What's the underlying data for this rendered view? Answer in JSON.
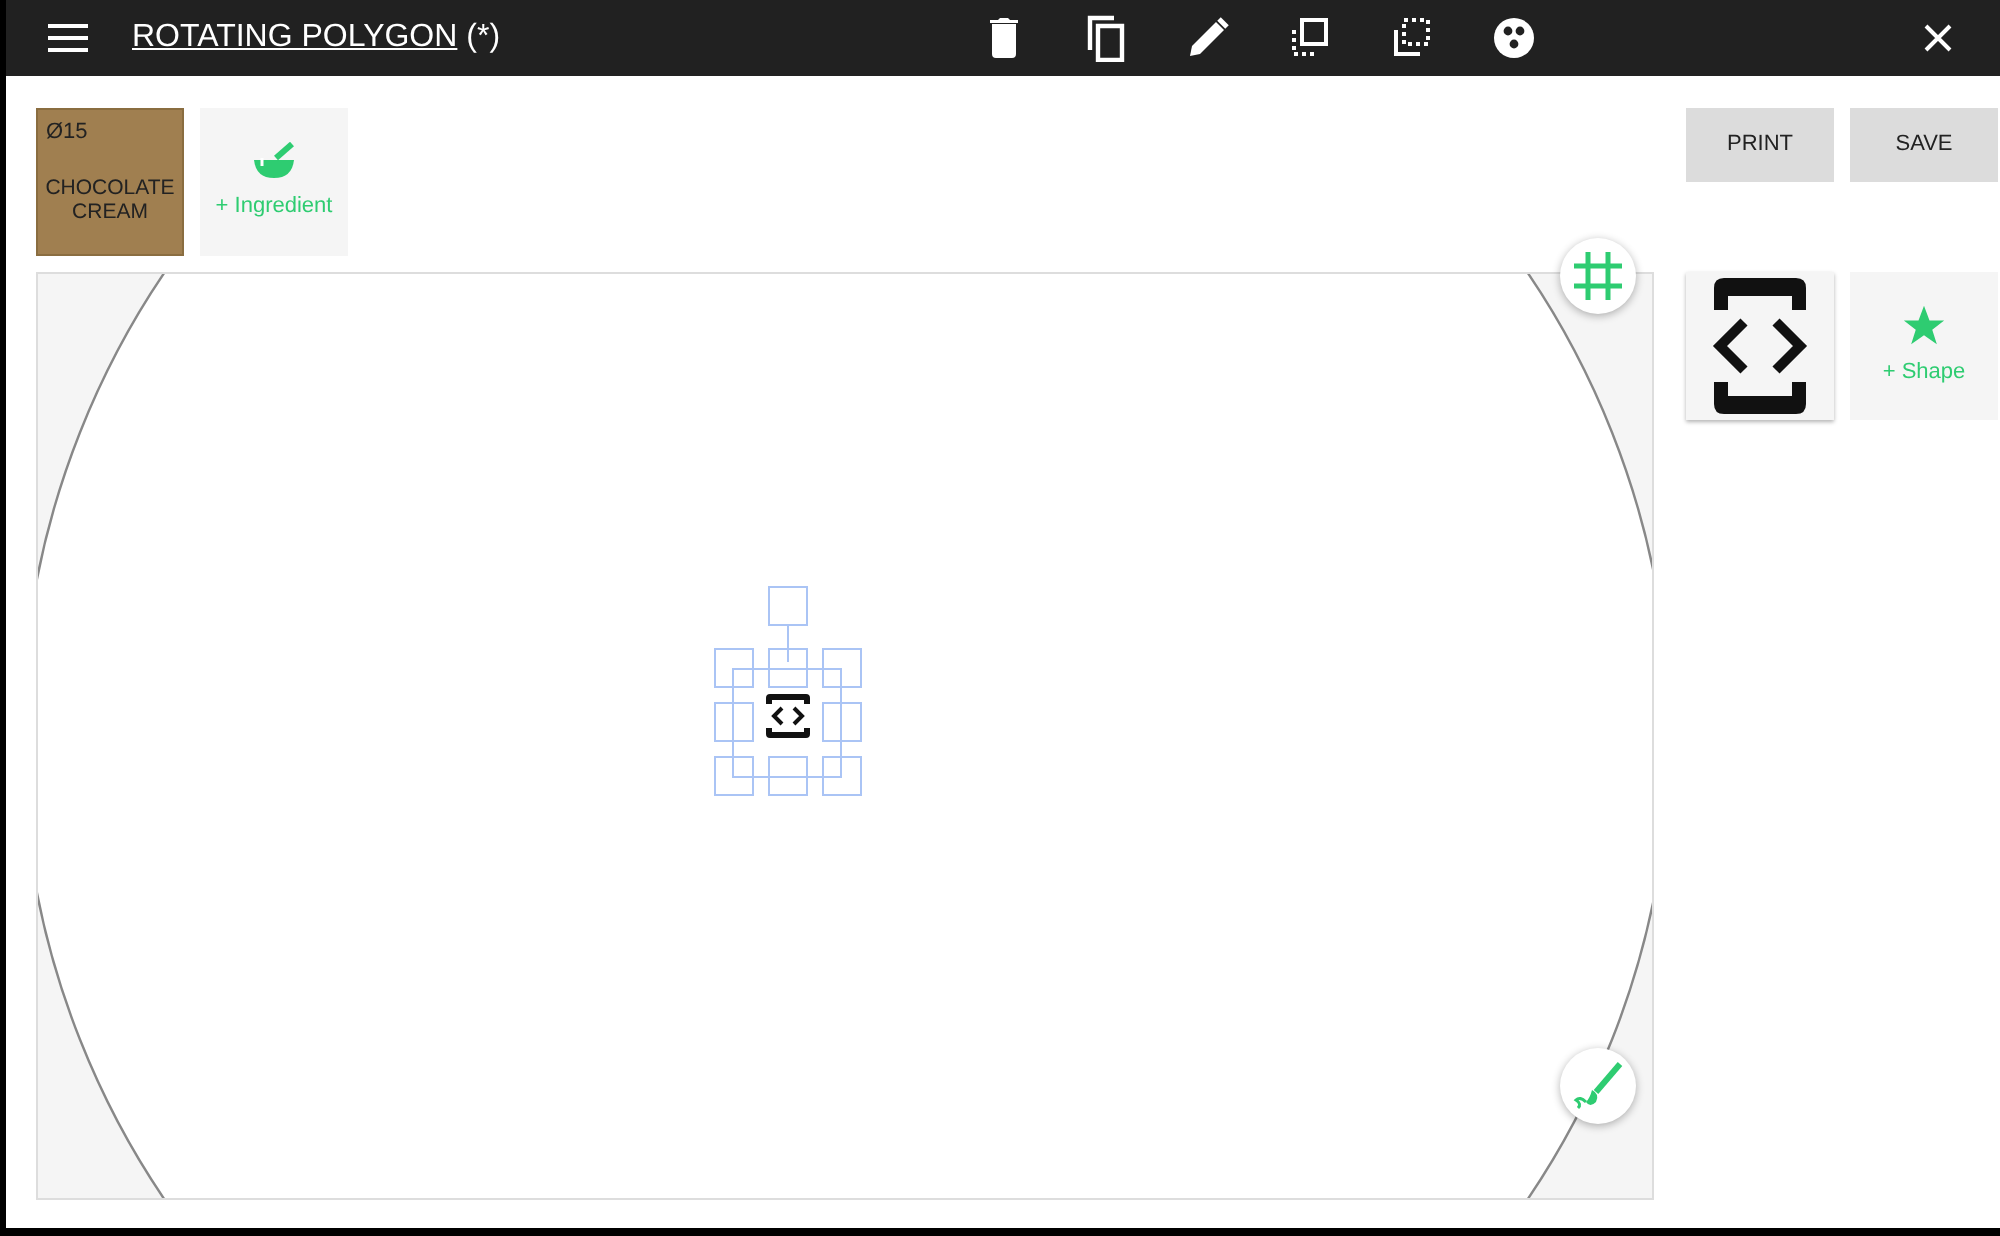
{
  "app_bar": {
    "title": "ROTATING POLYGON",
    "modified_mark": "(*)",
    "actions": [
      {
        "kind": "delete"
      },
      {
        "kind": "copy"
      },
      {
        "kind": "edit"
      },
      {
        "kind": "select-front"
      },
      {
        "kind": "select-back"
      },
      {
        "kind": "palette"
      }
    ]
  },
  "ingredients": [
    {
      "diameter": "Ø15",
      "name": "CHOCOLATE CREAM",
      "color": "#a07f50"
    }
  ],
  "add_ingredient": {
    "label": "+ Ingredient"
  },
  "buttons": [
    {
      "label": "PRINT"
    },
    {
      "label": "SAVE"
    }
  ],
  "add_shape": {
    "label": "+ Shape"
  }
}
